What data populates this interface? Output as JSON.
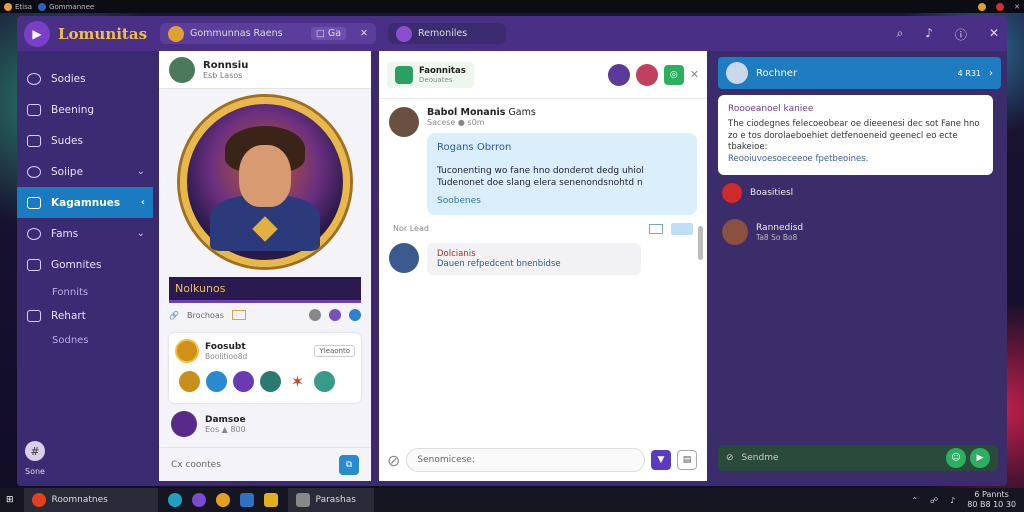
{
  "topbar": {
    "tab1": "Etisa",
    "tab2": "Gommannee"
  },
  "app": {
    "brand": "Lomunitas"
  },
  "tabs": [
    {
      "label": "Gommunnas Raens",
      "aux": "□ Ga"
    },
    {
      "label": "Remoniles"
    }
  ],
  "sidebar": {
    "items": [
      {
        "label": "Sodies"
      },
      {
        "label": "Beening"
      },
      {
        "label": "Sudes"
      },
      {
        "label": "Soiipe"
      },
      {
        "label": "Kagamnues",
        "active": true
      },
      {
        "label": "Fams"
      },
      {
        "label": "Gomnites"
      }
    ],
    "subs": [
      "Fonnits",
      "Rehart",
      "Sodnes"
    ],
    "footer": "Sone"
  },
  "profile": {
    "name": "Ronnsiu",
    "sub": "Esb  Lasos",
    "banner": "Nolkunos",
    "meta": "Brochoas",
    "card": {
      "title": "Foosubt",
      "badge": "Yleaonto",
      "sub": "Boolitioo8d"
    },
    "user2": {
      "name": "Damsoe",
      "sub": "Eos  ▲  800"
    },
    "footer": "Cx coontes"
  },
  "chat": {
    "group": {
      "title": "Faonnitas",
      "sub": "Deouates"
    },
    "msg1": {
      "name": "Babol Monanis",
      "tag": "Gams",
      "meta": "Sacese  ●  s0m",
      "title": "Rogans Obrron",
      "text": "Tuconenting wo fane hno donderot dedg uhiol Tudenonet doe slang elera senenondsnohtd n",
      "sig": "Soobenes"
    },
    "meta": "Nor  Lead",
    "msg2": {
      "title": "Dolcianis",
      "text": "Dauen refpedcent bnenbidse"
    },
    "input": "Senomicese:"
  },
  "right": {
    "head": {
      "name": "Rochner",
      "badge": "4 R31"
    },
    "note": {
      "title": "Roooeanoel kaniee",
      "text": "The ciodegnes felecoeobear oe dieeenesi dec sot Fane hno zo e tos dorolaeboehiet detfenoeneid geenecl eo ecte tbakeioe:",
      "link": "Reooiuvoesoeceeoe fpetbeoines."
    },
    "items": [
      {
        "name": "Boasitiesl",
        "sub": ""
      },
      {
        "name": "Rannedisd",
        "sub": "Ta8  So  Bo8"
      }
    ],
    "input": "Sendme"
  },
  "taskbar": {
    "app1": "Roomnatnes",
    "app2": "Parashas",
    "clock": "6 Pannts",
    "date": "80 B8 10 30"
  }
}
